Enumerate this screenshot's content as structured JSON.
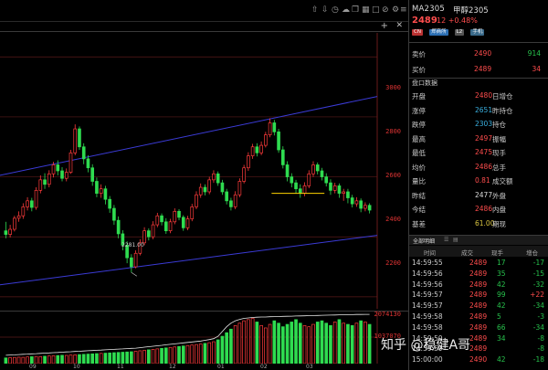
{
  "topbar": {
    "icons": [
      "arrow-up-icon",
      "arrow-down-icon",
      "clock-icon",
      "cloud-icon",
      "copy-icon",
      "grid-icon",
      "page-icon",
      "slash-icon",
      "pin-icon",
      "list-icon",
      "layout-icon"
    ]
  },
  "chart": {
    "price_ticks": [
      "3000",
      "2800",
      "2600",
      "2400",
      "2200"
    ],
    "volume_ticks": [
      "2074130",
      "1037070"
    ],
    "date_ticks": [
      {
        "label": "09",
        "x": "09"
      },
      {
        "label": "10",
        "x": "10"
      },
      {
        "label": "11",
        "x": "11"
      },
      {
        "label": "12",
        "x": "12"
      },
      {
        "label": "01",
        "x": "01"
      },
      {
        "label": "02",
        "x": "02"
      },
      {
        "label": "03",
        "x": "03"
      }
    ],
    "low_label": "2281.00"
  },
  "chart_data": {
    "type": "candlestick",
    "ylim": [
      2160,
      3080
    ],
    "volume_max": 2074130,
    "annotations": {
      "channel_upper": [
        [
          0,
          2605
        ],
        [
          100,
          2868
        ]
      ],
      "channel_lower": [
        [
          0,
          2240
        ],
        [
          100,
          2405
        ]
      ],
      "horizontal_level": 2545,
      "horizontal_range": [
        72,
        86
      ],
      "low_marker": 2281.0
    },
    "candles": [
      [
        2420,
        2408,
        2450,
        2395
      ],
      [
        2408,
        2425,
        2440,
        2398
      ],
      [
        2425,
        2462,
        2470,
        2418
      ],
      [
        2462,
        2470,
        2485,
        2450
      ],
      [
        2470,
        2500,
        2512,
        2460
      ],
      [
        2500,
        2520,
        2532,
        2488
      ],
      [
        2520,
        2498,
        2530,
        2485
      ],
      [
        2498,
        2555,
        2565,
        2490
      ],
      [
        2555,
        2590,
        2605,
        2545
      ],
      [
        2590,
        2575,
        2612,
        2560
      ],
      [
        2575,
        2610,
        2622,
        2565
      ],
      [
        2610,
        2640,
        2650,
        2598
      ],
      [
        2640,
        2620,
        2655,
        2605
      ],
      [
        2620,
        2595,
        2632,
        2585
      ],
      [
        2595,
        2615,
        2628,
        2585
      ],
      [
        2615,
        2680,
        2690,
        2610
      ],
      [
        2680,
        2760,
        2775,
        2672
      ],
      [
        2760,
        2700,
        2768,
        2690
      ],
      [
        2700,
        2660,
        2712,
        2642
      ],
      [
        2660,
        2630,
        2672,
        2615
      ],
      [
        2630,
        2585,
        2642,
        2570
      ],
      [
        2585,
        2545,
        2598,
        2532
      ],
      [
        2545,
        2560,
        2575,
        2530
      ],
      [
        2560,
        2525,
        2570,
        2508
      ],
      [
        2525,
        2495,
        2536,
        2480
      ],
      [
        2495,
        2455,
        2506,
        2440
      ],
      [
        2455,
        2410,
        2468,
        2395
      ],
      [
        2410,
        2372,
        2422,
        2355
      ],
      [
        2372,
        2330,
        2385,
        2312
      ],
      [
        2330,
        2300,
        2342,
        2281
      ],
      [
        2300,
        2345,
        2355,
        2295
      ],
      [
        2345,
        2380,
        2392,
        2338
      ],
      [
        2380,
        2420,
        2432,
        2372
      ],
      [
        2420,
        2400,
        2428,
        2388
      ],
      [
        2400,
        2440,
        2452,
        2392
      ],
      [
        2440,
        2470,
        2480,
        2432
      ],
      [
        2470,
        2450,
        2478,
        2438
      ],
      [
        2450,
        2420,
        2462,
        2410
      ],
      [
        2420,
        2450,
        2460,
        2412
      ],
      [
        2450,
        2485,
        2495,
        2442
      ],
      [
        2485,
        2465,
        2492,
        2455
      ],
      [
        2465,
        2430,
        2472,
        2420
      ],
      [
        2430,
        2460,
        2470,
        2422
      ],
      [
        2460,
        2500,
        2510,
        2452
      ],
      [
        2500,
        2540,
        2552,
        2492
      ],
      [
        2540,
        2565,
        2578,
        2530
      ],
      [
        2565,
        2550,
        2575,
        2538
      ],
      [
        2550,
        2590,
        2600,
        2542
      ],
      [
        2590,
        2610,
        2622,
        2580
      ],
      [
        2610,
        2580,
        2618,
        2570
      ],
      [
        2580,
        2550,
        2590,
        2540
      ],
      [
        2550,
        2520,
        2560,
        2508
      ],
      [
        2520,
        2500,
        2530,
        2488
      ],
      [
        2500,
        2540,
        2552,
        2492
      ],
      [
        2540,
        2585,
        2595,
        2532
      ],
      [
        2585,
        2630,
        2640,
        2578
      ],
      [
        2630,
        2670,
        2682,
        2620
      ],
      [
        2670,
        2700,
        2710,
        2660
      ],
      [
        2700,
        2680,
        2712,
        2668
      ],
      [
        2680,
        2705,
        2718,
        2672
      ],
      [
        2705,
        2740,
        2750,
        2698
      ],
      [
        2740,
        2780,
        2795,
        2732
      ],
      [
        2780,
        2750,
        2790,
        2738
      ],
      [
        2750,
        2690,
        2760,
        2680
      ],
      [
        2690,
        2640,
        2702,
        2628
      ],
      [
        2640,
        2600,
        2652,
        2585
      ],
      [
        2600,
        2580,
        2612,
        2565
      ],
      [
        2580,
        2560,
        2590,
        2545
      ],
      [
        2560,
        2545,
        2575,
        2530
      ],
      [
        2545,
        2570,
        2582,
        2535
      ],
      [
        2570,
        2610,
        2622,
        2562
      ],
      [
        2610,
        2640,
        2652,
        2600
      ],
      [
        2640,
        2620,
        2648,
        2608
      ],
      [
        2620,
        2600,
        2630,
        2588
      ],
      [
        2600,
        2580,
        2612,
        2568
      ],
      [
        2580,
        2555,
        2592,
        2540
      ],
      [
        2555,
        2570,
        2580,
        2545
      ],
      [
        2570,
        2545,
        2578,
        2530
      ],
      [
        2545,
        2550,
        2560,
        2520
      ],
      [
        2550,
        2530,
        2560,
        2512
      ],
      [
        2530,
        2510,
        2540,
        2498
      ],
      [
        2510,
        2520,
        2532,
        2500
      ],
      [
        2520,
        2495,
        2528,
        2482
      ],
      [
        2495,
        2505,
        2515,
        2485
      ],
      [
        2505,
        2489,
        2512,
        2478
      ]
    ],
    "volumes": [
      240000,
      250000,
      260000,
      270000,
      265000,
      280000,
      290000,
      300000,
      295000,
      310000,
      320000,
      330000,
      340000,
      350000,
      345000,
      360000,
      370000,
      380000,
      390000,
      400000,
      410000,
      420000,
      430000,
      440000,
      450000,
      460000,
      470000,
      480000,
      490000,
      500000,
      520000,
      540000,
      560000,
      580000,
      600000,
      620000,
      640000,
      660000,
      680000,
      700000,
      720000,
      740000,
      760000,
      780000,
      800000,
      820000,
      850000,
      880000,
      920000,
      1000000,
      1150000,
      1300000,
      1450000,
      1600000,
      1700000,
      1800000,
      1850000,
      1900000,
      1750000,
      1600000,
      1500000,
      1650000,
      1800000,
      1700000,
      1550000,
      1650000,
      1750000,
      1850000,
      1700000,
      1600000,
      1550000,
      1650000,
      1750000,
      1800000,
      1700000,
      1600000,
      1750000,
      1850000,
      1700000,
      1650000,
      1600000,
      1700000,
      1800000,
      1750000,
      1650000
    ],
    "open_interest": [
      350000,
      360000,
      370000,
      380000,
      390000,
      400000,
      410000,
      420000,
      430000,
      440000,
      450000,
      460000,
      470000,
      480000,
      490000,
      500000,
      510000,
      520000,
      530000,
      540000,
      550000,
      560000,
      570000,
      580000,
      590000,
      600000,
      610000,
      620000,
      630000,
      640000,
      650000,
      670000,
      690000,
      710000,
      730000,
      750000,
      770000,
      790000,
      810000,
      830000,
      850000,
      870000,
      890000,
      910000,
      930000,
      950000,
      980000,
      1010000,
      1050000,
      1150000,
      1350000,
      1550000,
      1700000,
      1800000,
      1860000,
      1900000,
      1920000,
      1940000,
      1950000,
      1960000,
      1960000,
      1970000,
      1975000,
      1980000,
      1985000,
      1990000,
      1995000,
      2000000,
      2005000,
      2010000,
      2015000,
      2020000,
      2025000,
      2030000,
      2035000,
      2040000,
      2045000,
      2050000,
      2055000,
      2060000,
      2060000,
      2065000,
      2068000,
      2070000,
      2072000
    ]
  },
  "panel": {
    "symbol_code": "MA2305",
    "symbol_name": "甲醇2305",
    "last_price": "2489",
    "change": "12 +0.48%",
    "tags": [
      "CN",
      "郑商所",
      "L2",
      "手机"
    ],
    "orderbook": {
      "sell_label": "卖价",
      "sell_price": "2490",
      "sell_vol": "914",
      "buy_label": "买价",
      "buy_price": "2489",
      "buy_vol": "34"
    },
    "section_title": "盘口数据",
    "stats": [
      {
        "l": "开盘",
        "v": "2480",
        "vc": "red",
        "r": "日增仓"
      },
      {
        "l": "涨停",
        "v": "2651",
        "vc": "cyan",
        "r": "昨持仓"
      },
      {
        "l": "跌停",
        "v": "2303",
        "vc": "cyan",
        "r": "持仓"
      },
      {
        "l": "最高",
        "v": "2497",
        "vc": "red",
        "r": "振幅"
      },
      {
        "l": "最低",
        "v": "2475",
        "vc": "red",
        "r": "现手"
      },
      {
        "l": "均价",
        "v": "2486",
        "vc": "red",
        "r": "总手"
      },
      {
        "l": "量比",
        "v": "0.81",
        "vc": "red",
        "r": "成交额"
      },
      {
        "l": "昨结",
        "v": "2477",
        "vc": "white",
        "r": "外盘"
      },
      {
        "l": "今结",
        "v": "2486",
        "vc": "red",
        "r": "内盘"
      },
      {
        "l": "基差",
        "v": "61.00",
        "vc": "yel",
        "r": "期现"
      }
    ],
    "tick_tab": "全部明细",
    "tick_header": [
      "时间",
      "成交",
      "现手",
      "增仓"
    ],
    "ticks": [
      {
        "t": "14:59:55",
        "p": "2489",
        "v": "17",
        "vc": "green",
        "a": "-17",
        "ac": "green"
      },
      {
        "t": "14:59:56",
        "p": "2489",
        "v": "35",
        "vc": "green",
        "a": "-15",
        "ac": "green"
      },
      {
        "t": "14:59:56",
        "p": "2489",
        "v": "42",
        "vc": "green",
        "a": "-32",
        "ac": "green"
      },
      {
        "t": "14:59:57",
        "p": "2489",
        "v": "99",
        "vc": "green",
        "a": "+22",
        "ac": "red"
      },
      {
        "t": "14:59:57",
        "p": "2489",
        "v": "42",
        "vc": "green",
        "a": "-34",
        "ac": "green"
      },
      {
        "t": "14:59:58",
        "p": "2489",
        "v": "5",
        "vc": "green",
        "a": "-3",
        "ac": "green"
      },
      {
        "t": "14:59:58",
        "p": "2489",
        "v": "66",
        "vc": "green",
        "a": "-34",
        "ac": "green"
      },
      {
        "t": "14:59:59",
        "p": "2489",
        "v": "34",
        "vc": "green",
        "a": "-8",
        "ac": "green"
      },
      {
        "t": "14:59:59",
        "p": "2489",
        "v": "",
        "vc": "green",
        "a": "-8",
        "ac": "green"
      },
      {
        "t": "15:00:00",
        "p": "2490",
        "v": "42",
        "vc": "green",
        "a": "-18",
        "ac": "green"
      }
    ]
  },
  "watermark": {
    "text": "知乎 @稳健A哥"
  }
}
